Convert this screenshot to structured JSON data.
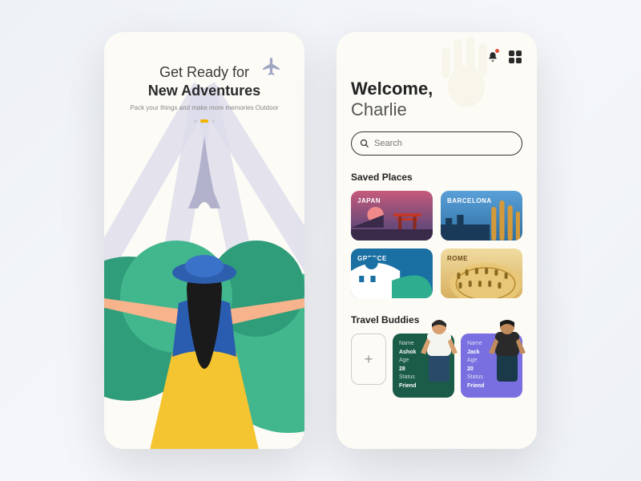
{
  "onboarding": {
    "title_line1": "Get Ready for",
    "title_line2": "New Adventures",
    "subtitle": "Pack your things and make more memories Outdoor",
    "page_index": 1,
    "page_count": 3
  },
  "home": {
    "welcome_label": "Welcome,",
    "user_name": "Charlie",
    "search_placeholder": "Search",
    "saved_places_heading": "Saved Places",
    "places": [
      {
        "name": "JAPAN"
      },
      {
        "name": "BARCELONA"
      },
      {
        "name": "GREECE"
      },
      {
        "name": "ROME"
      }
    ],
    "travel_buddies_heading": "Travel Buddies",
    "add_label": "+",
    "buddies": [
      {
        "name_label": "Name",
        "name": "Ashok",
        "age_label": "Age",
        "age": "28",
        "status_label": "Status",
        "status": "Friend"
      },
      {
        "name_label": "Name",
        "name": "Jack",
        "age_label": "Age",
        "age": "20",
        "status_label": "Status",
        "status": "Friend"
      }
    ]
  },
  "colors": {
    "accent_yellow": "#f2b200",
    "buddy_green": "#1a5c48",
    "buddy_violet": "#7a6fe0"
  }
}
